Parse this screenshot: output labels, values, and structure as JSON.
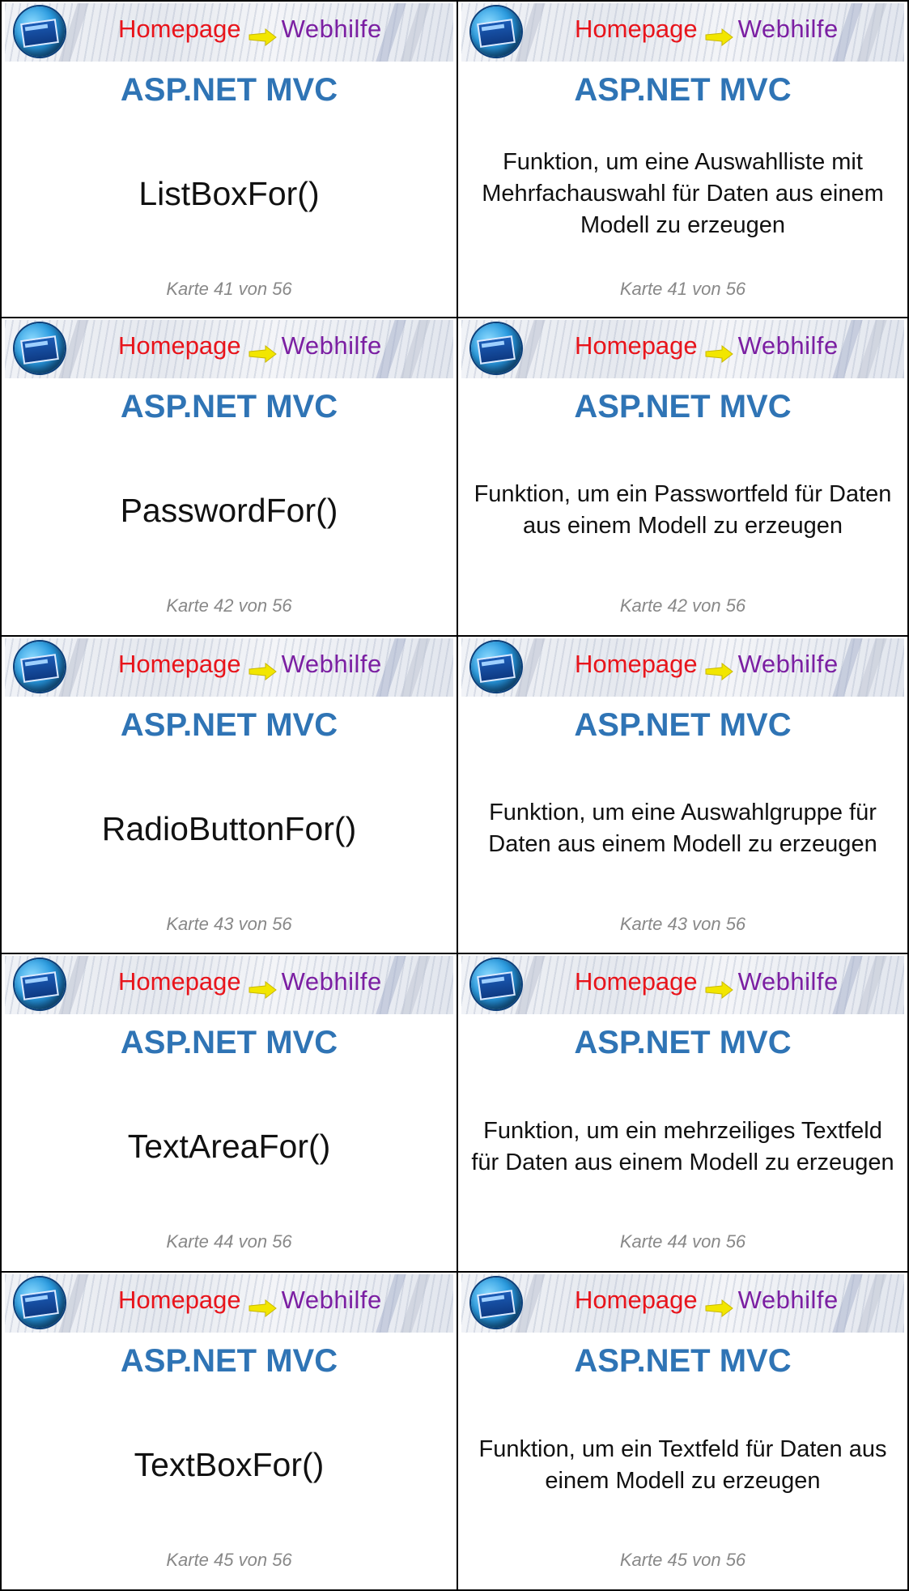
{
  "header": {
    "logo_home": "Homepage",
    "logo_web": "Webhilfe",
    "subject": "ASP.NET MVC"
  },
  "colors": {
    "subject": "#2f74b5",
    "logo_home": "#e8141b",
    "logo_web": "#7b1fa2",
    "arrow": "#f2e600",
    "footer": "#888888"
  },
  "cards": [
    {
      "front": "ListBoxFor()",
      "back": "Funktion, um eine Auswahlliste mit Mehrfachauswahl für Daten aus einem Modell zu erzeugen",
      "footer": "Karte 41 von 56"
    },
    {
      "front": "PasswordFor()",
      "back": "Funktion, um ein Passwortfeld für Daten aus einem Modell zu erzeugen",
      "footer": "Karte 42 von 56"
    },
    {
      "front": "RadioButtonFor()",
      "back": "Funktion, um eine Auswahlgruppe für Daten aus einem Modell zu erzeugen",
      "footer": "Karte 43 von 56"
    },
    {
      "front": "TextAreaFor()",
      "back": "Funktion, um ein mehrzeiliges Textfeld für Daten aus einem Modell zu erzeugen",
      "footer": "Karte 44 von 56"
    },
    {
      "front": "TextBoxFor()",
      "back": "Funktion, um ein Textfeld für Daten aus einem Modell zu erzeugen",
      "footer": "Karte 45 von 56"
    }
  ]
}
